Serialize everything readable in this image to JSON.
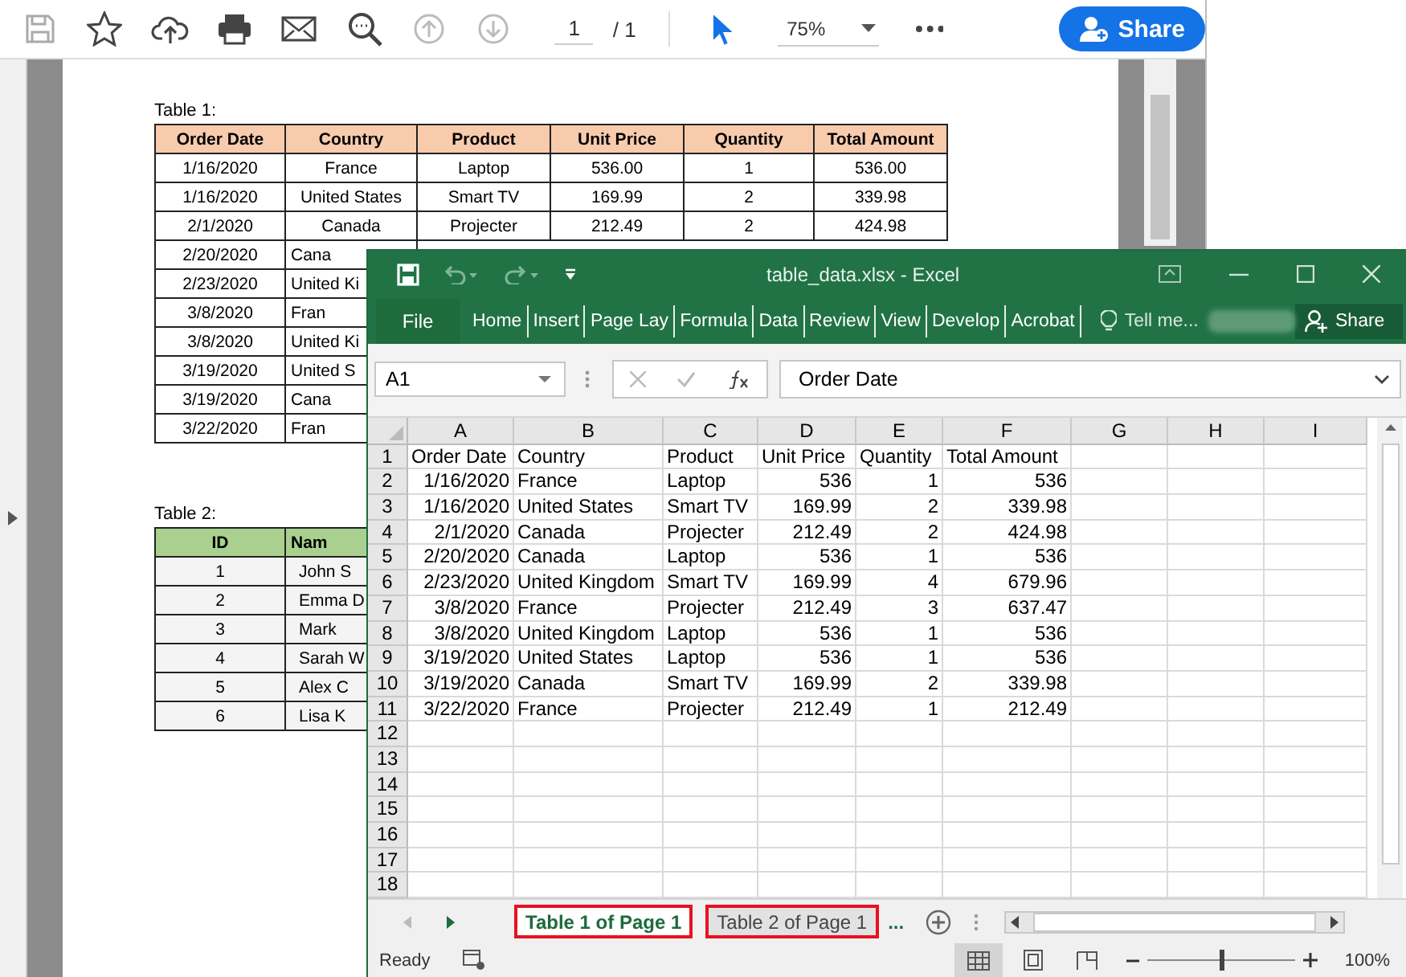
{
  "pdf_toolbar": {
    "page_field": {
      "value": "1"
    },
    "page_total": "/ 1",
    "zoom": "75%",
    "share_button": "Share"
  },
  "pdf_page": {
    "tables": [
      {
        "caption": "Table 1:",
        "color": "#f8cbad",
        "columns": [
          "Order Date",
          "Country",
          "Product",
          "Unit Price",
          "Quantity",
          "Total Amount"
        ],
        "rows": [
          {
            "cells": [
              "1/16/2020",
              "France",
              "Laptop",
              "536.00",
              "1",
              "536.00"
            ]
          },
          {
            "cells": [
              "1/16/2020",
              "United States",
              "Smart TV",
              "169.99",
              "2",
              "339.98"
            ]
          },
          {
            "cells": [
              "2/1/2020",
              "Canada",
              "Projecter",
              "212.49",
              "2",
              "424.98"
            ]
          },
          {
            "cells": [
              "2/20/2020",
              "Cana"
            ]
          },
          {
            "cells": [
              "2/23/2020",
              "United Ki"
            ]
          },
          {
            "cells": [
              "3/8/2020",
              "Fran"
            ]
          },
          {
            "cells": [
              "3/8/2020",
              "United Ki"
            ]
          },
          {
            "cells": [
              "3/19/2020",
              "United S"
            ]
          },
          {
            "cells": [
              "3/19/2020",
              "Cana"
            ]
          },
          {
            "cells": [
              "3/22/2020",
              "Fran"
            ]
          }
        ]
      },
      {
        "caption": "Table 2:",
        "color": "#a9d08e",
        "columns": [
          "ID",
          "Nam"
        ],
        "rows": [
          {
            "cells": [
              "1",
              "John S"
            ]
          },
          {
            "cells": [
              "2",
              "Emma D"
            ]
          },
          {
            "cells": [
              "3",
              "Mark"
            ]
          },
          {
            "cells": [
              "4",
              "Sarah W"
            ]
          },
          {
            "cells": [
              "5",
              "Alex C"
            ]
          },
          {
            "cells": [
              "6",
              "Lisa K"
            ]
          }
        ]
      }
    ]
  },
  "excel": {
    "title": "table_data.xlsx - Excel",
    "ribbon_tabs": [
      {
        "label": "File",
        "kind": "backstage"
      },
      {
        "label": "Home",
        "kind": "tab"
      },
      {
        "label": "Insert",
        "kind": "tab"
      },
      {
        "label": "Page Lay",
        "kind": "tab"
      },
      {
        "label": "Formula",
        "kind": "tab"
      },
      {
        "label": "Data",
        "kind": "tab"
      },
      {
        "label": "Review",
        "kind": "tab"
      },
      {
        "label": "View",
        "kind": "tab"
      },
      {
        "label": "Develop",
        "kind": "tab"
      },
      {
        "label": "Acrobat",
        "kind": "tab"
      }
    ],
    "tell_me": "Tell me...",
    "share_button": "Share",
    "name_box": "A1",
    "formula": "Order Date",
    "columns": [
      "A",
      "B",
      "C",
      "D",
      "E",
      "F",
      "G",
      "H",
      "I"
    ],
    "rows": [
      {
        "number": "1",
        "cells": [
          "Order Date",
          "Country",
          "Product",
          "Unit Price",
          "Quantity",
          "Total Amount"
        ]
      },
      {
        "number": "2",
        "cells": [
          "1/16/2020",
          "France",
          "Laptop",
          "536",
          "1",
          "536"
        ]
      },
      {
        "number": "3",
        "cells": [
          "1/16/2020",
          "United States",
          "Smart TV",
          "169.99",
          "2",
          "339.98"
        ]
      },
      {
        "number": "4",
        "cells": [
          "2/1/2020",
          "Canada",
          "Projecter",
          "212.49",
          "2",
          "424.98"
        ]
      },
      {
        "number": "5",
        "cells": [
          "2/20/2020",
          "Canada",
          "Laptop",
          "536",
          "1",
          "536"
        ]
      },
      {
        "number": "6",
        "cells": [
          "2/23/2020",
          "United Kingdom",
          "Smart TV",
          "169.99",
          "4",
          "679.96"
        ]
      },
      {
        "number": "7",
        "cells": [
          "3/8/2020",
          "France",
          "Projecter",
          "212.49",
          "3",
          "637.47"
        ]
      },
      {
        "number": "8",
        "cells": [
          "3/8/2020",
          "United Kingdom",
          "Laptop",
          "536",
          "1",
          "536"
        ]
      },
      {
        "number": "9",
        "cells": [
          "3/19/2020",
          "United States",
          "Laptop",
          "536",
          "1",
          "536"
        ]
      },
      {
        "number": "10",
        "cells": [
          "3/19/2020",
          "Canada",
          "Smart TV",
          "169.99",
          "2",
          "339.98"
        ]
      },
      {
        "number": "11",
        "cells": [
          "3/22/2020",
          "France",
          "Projecter",
          "212.49",
          "1",
          "212.49"
        ]
      },
      {
        "number": "12",
        "cells": []
      },
      {
        "number": "13",
        "cells": []
      },
      {
        "number": "14",
        "cells": []
      },
      {
        "number": "15",
        "cells": []
      },
      {
        "number": "16",
        "cells": []
      },
      {
        "number": "17",
        "cells": []
      },
      {
        "number": "18",
        "cells": []
      }
    ],
    "sheet_tabs": [
      {
        "label": "Table 1 of Page 1",
        "selected": true,
        "highlighted": true
      },
      {
        "label": "Table 2 of Page 1",
        "selected": false,
        "highlighted": true
      }
    ],
    "more_tabs": "...",
    "status": "Ready",
    "views": [
      {
        "kind": "normal",
        "selected": true
      },
      {
        "kind": "page-layout",
        "selected": false
      },
      {
        "kind": "page-break",
        "selected": false
      }
    ],
    "zoom": {
      "level": 0.5,
      "reading": "100%"
    }
  }
}
